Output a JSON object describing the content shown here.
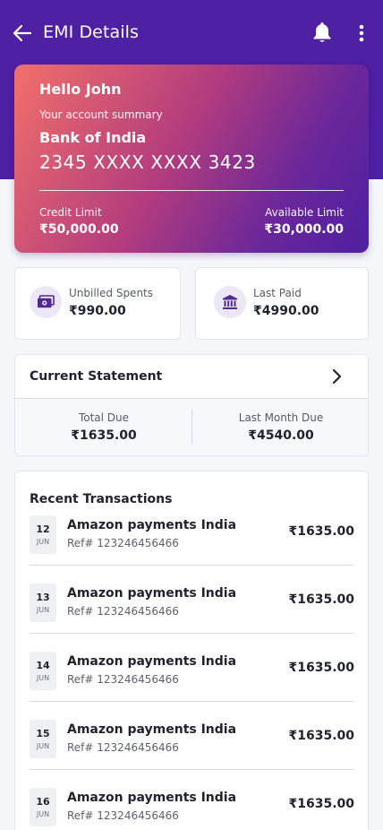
{
  "header": {
    "title": "EMI Details",
    "back_icon": "arrow-left-icon",
    "bell_icon": "bell-icon",
    "more_icon": "more-vertical-icon"
  },
  "account": {
    "greeting": "Hello John",
    "subtitle": "Your account summary",
    "bank": "Bank of India",
    "card_number": "2345 XXXX XXXX 3423",
    "credit_limit_label": "Credit Limit",
    "credit_limit_value": "₹50,000.00",
    "available_limit_label": "Available Limit",
    "available_limit_value": "₹30,000.00"
  },
  "summary": {
    "unbilled": {
      "label": "Unbilled Spents",
      "value": "₹990.00",
      "icon": "cash-icon"
    },
    "last_paid": {
      "label": "Last Paid",
      "value": "₹4990.00",
      "icon": "bank-icon"
    }
  },
  "statement": {
    "title": "Current Statement",
    "total_due_label": "Total Due",
    "total_due_value": "₹1635.00",
    "last_month_label": "Last Month Due",
    "last_month_value": "₹4540.00"
  },
  "transactions": {
    "title": "Recent Transactions",
    "items": [
      {
        "day": "12",
        "month": "JUN",
        "name": "Amazon payments India",
        "ref": "Ref# 123246456466",
        "amount": "₹1635.00"
      },
      {
        "day": "13",
        "month": "JUN",
        "name": "Amazon payments India",
        "ref": "Ref# 123246456466",
        "amount": "₹1635.00"
      },
      {
        "day": "14",
        "month": "JUN",
        "name": "Amazon payments India",
        "ref": "Ref# 123246456466",
        "amount": "₹1635.00"
      },
      {
        "day": "15",
        "month": "JUN",
        "name": "Amazon payments India",
        "ref": "Ref# 123246456466",
        "amount": "₹1635.00"
      },
      {
        "day": "16",
        "month": "JUN",
        "name": "Amazon payments India",
        "ref": "Ref# 123246456466",
        "amount": "₹1635.00"
      }
    ]
  },
  "colors": {
    "header": "#4f20a3",
    "card_gradient_start": "#f2706a",
    "card_gradient_end": "#4e1fa0",
    "icon_accent": "#4f2a8f",
    "icon_bg": "#ece6f6"
  }
}
